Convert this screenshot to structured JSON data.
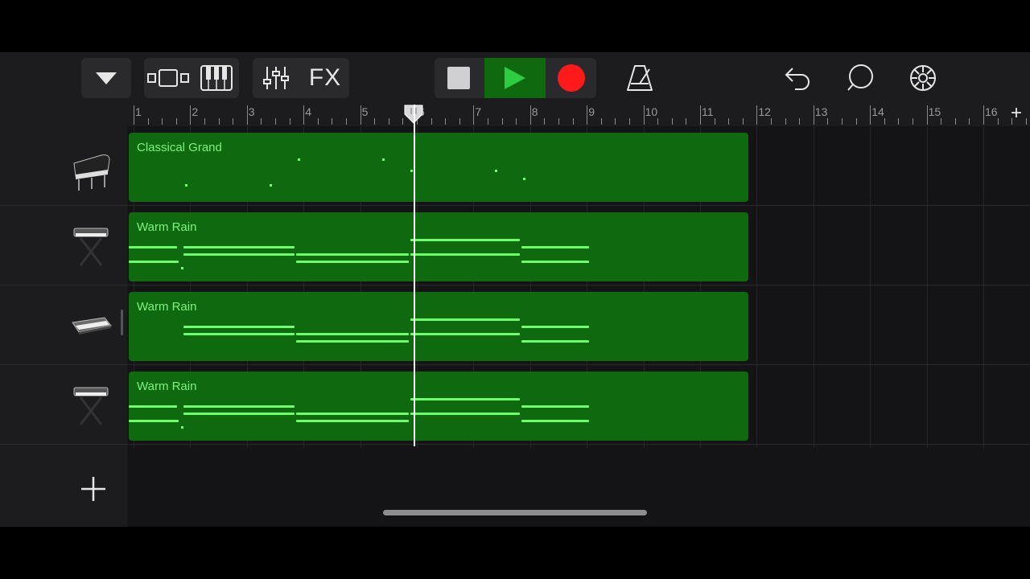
{
  "toolbar": {
    "icons": [
      "browser-dropdown-icon",
      "tracks-view-icon",
      "keyboard-icon",
      "mixer-icon",
      "fx-icon",
      "stop-icon",
      "play-icon",
      "record-icon",
      "metronome-icon",
      "undo-icon",
      "loop-icon",
      "settings-icon"
    ],
    "fx_label": "FX",
    "colors": {
      "play": "#2ecc40",
      "record": "#ff1a1a",
      "play_bg": "#0f6a0f"
    }
  },
  "ruler": {
    "bars": [
      "1",
      "2",
      "3",
      "4",
      "5",
      "6",
      "7",
      "8",
      "9",
      "10",
      "11",
      "12",
      "13",
      "14",
      "15",
      "16"
    ],
    "add_label": "+"
  },
  "tracks": [
    {
      "instrument_icon": "grand-piano-icon",
      "region_name": "Classical Grand"
    },
    {
      "instrument_icon": "synth-keyboard-stand-icon",
      "region_name": "Warm Rain"
    },
    {
      "instrument_icon": "synth-keyboard-icon",
      "region_name": "Warm Rain"
    },
    {
      "instrument_icon": "synth-keyboard-stand-icon",
      "region_name": "Warm Rain"
    }
  ],
  "add_track_label": "+",
  "colors": {
    "region": "#0f6a0f",
    "note": "#6eff6e",
    "region_text": "#7ff07f",
    "playhead": "#ffffff"
  }
}
